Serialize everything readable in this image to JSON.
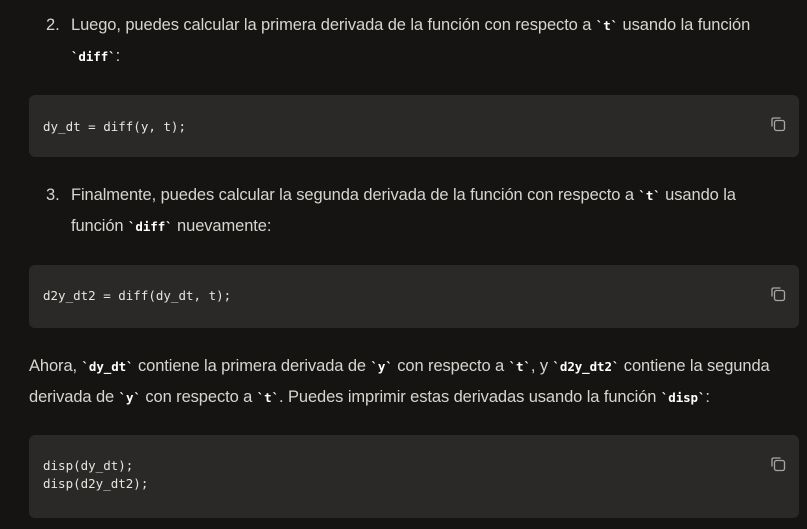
{
  "steps": [
    {
      "number": "2.",
      "text_before": "Luego, puedes calcular la primera derivada de la función con respecto a ",
      "code1": "`t`",
      "text_middle": " usando la función ",
      "code2": "`diff`",
      "text_after": ":"
    },
    {
      "number": "3.",
      "text_before": "Finalmente, puedes calcular la segunda derivada de la función con respecto a ",
      "code1": "`t`",
      "text_middle": " usando la función ",
      "code2": "`diff`",
      "text_after": " nuevamente:"
    }
  ],
  "code_blocks": [
    {
      "code": "dy_dt = diff(y, t);",
      "icon": "copy-icon"
    },
    {
      "code": "d2y_dt2 = diff(dy_dt, t);",
      "icon": "copy-icon"
    },
    {
      "code": "disp(dy_dt);\ndisp(d2y_dt2);",
      "icon": "copy-icon"
    }
  ],
  "summary": {
    "p1": "Ahora, ",
    "c1": "`dy_dt`",
    "p2": " contiene la primera derivada de ",
    "c2": "`y`",
    "p3": " con respecto a ",
    "c3": "`t`",
    "p4": ", y ",
    "c4": "`d2y_dt2`",
    "p5": " contiene la segunda derivada de ",
    "c5": "`y`",
    "p6": " con respecto a ",
    "c6": "`t`",
    "p7": ". Puedes imprimir estas derivadas usando la función ",
    "c7": "`disp`",
    "p8": ":"
  },
  "colors": {
    "background": "#161412",
    "code_block_background": "#2b2927",
    "text": "#d8d5d0",
    "inline_code": "#ffffff"
  }
}
